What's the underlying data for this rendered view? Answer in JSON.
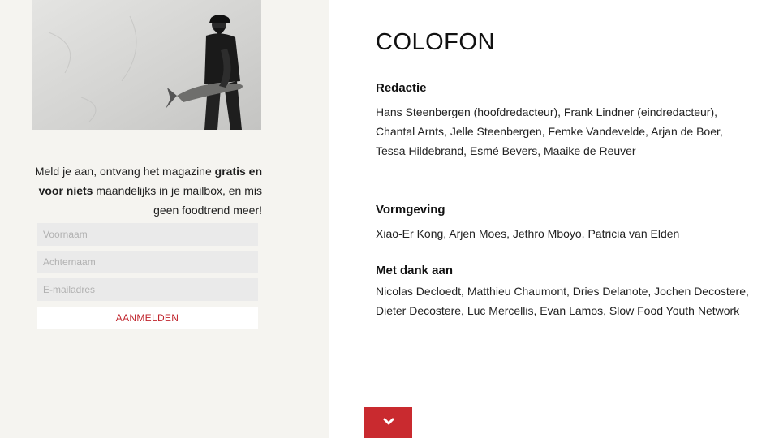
{
  "signup": {
    "text_before": "Meld je aan, ontvang het magazine ",
    "text_bold": "gratis en voor niets",
    "text_after": " maandelijks in je mailbox, en mis geen foodtrend meer!",
    "firstname_placeholder": "Voornaam",
    "lastname_placeholder": "Achternaam",
    "email_placeholder": "E-mailadres",
    "submit_label": "AANMELDEN"
  },
  "colofon": {
    "title": "COLOFON",
    "sections": [
      {
        "heading": "Redactie",
        "body": "Hans Steenbergen (hoofdredacteur), Frank Lindner (eindredacteur), Chantal Arnts, Jelle Steenbergen, Femke Vandevelde, Arjan de Boer, Tessa Hildebrand, Esmé Bevers, Maaike de Reuver"
      },
      {
        "heading": "Vormgeving",
        "body": "Xiao-Er Kong, Arjen Moes, Jethro Mboyo, Patricia van Elden"
      },
      {
        "heading": "Met dank aan",
        "body": "Nicolas Decloedt, Matthieu Chaumont, Dries Delanote, Jochen Decostere, Dieter Decostere, Luc Mercellis, Evan Lamos, Slow Food Youth Network"
      }
    ]
  },
  "icons": {
    "scroll_down": "chevron-down-icon"
  },
  "colors": {
    "accent": "#c92a2f",
    "left_panel_bg": "#f5f4f0",
    "field_bg": "#eaeaea"
  }
}
